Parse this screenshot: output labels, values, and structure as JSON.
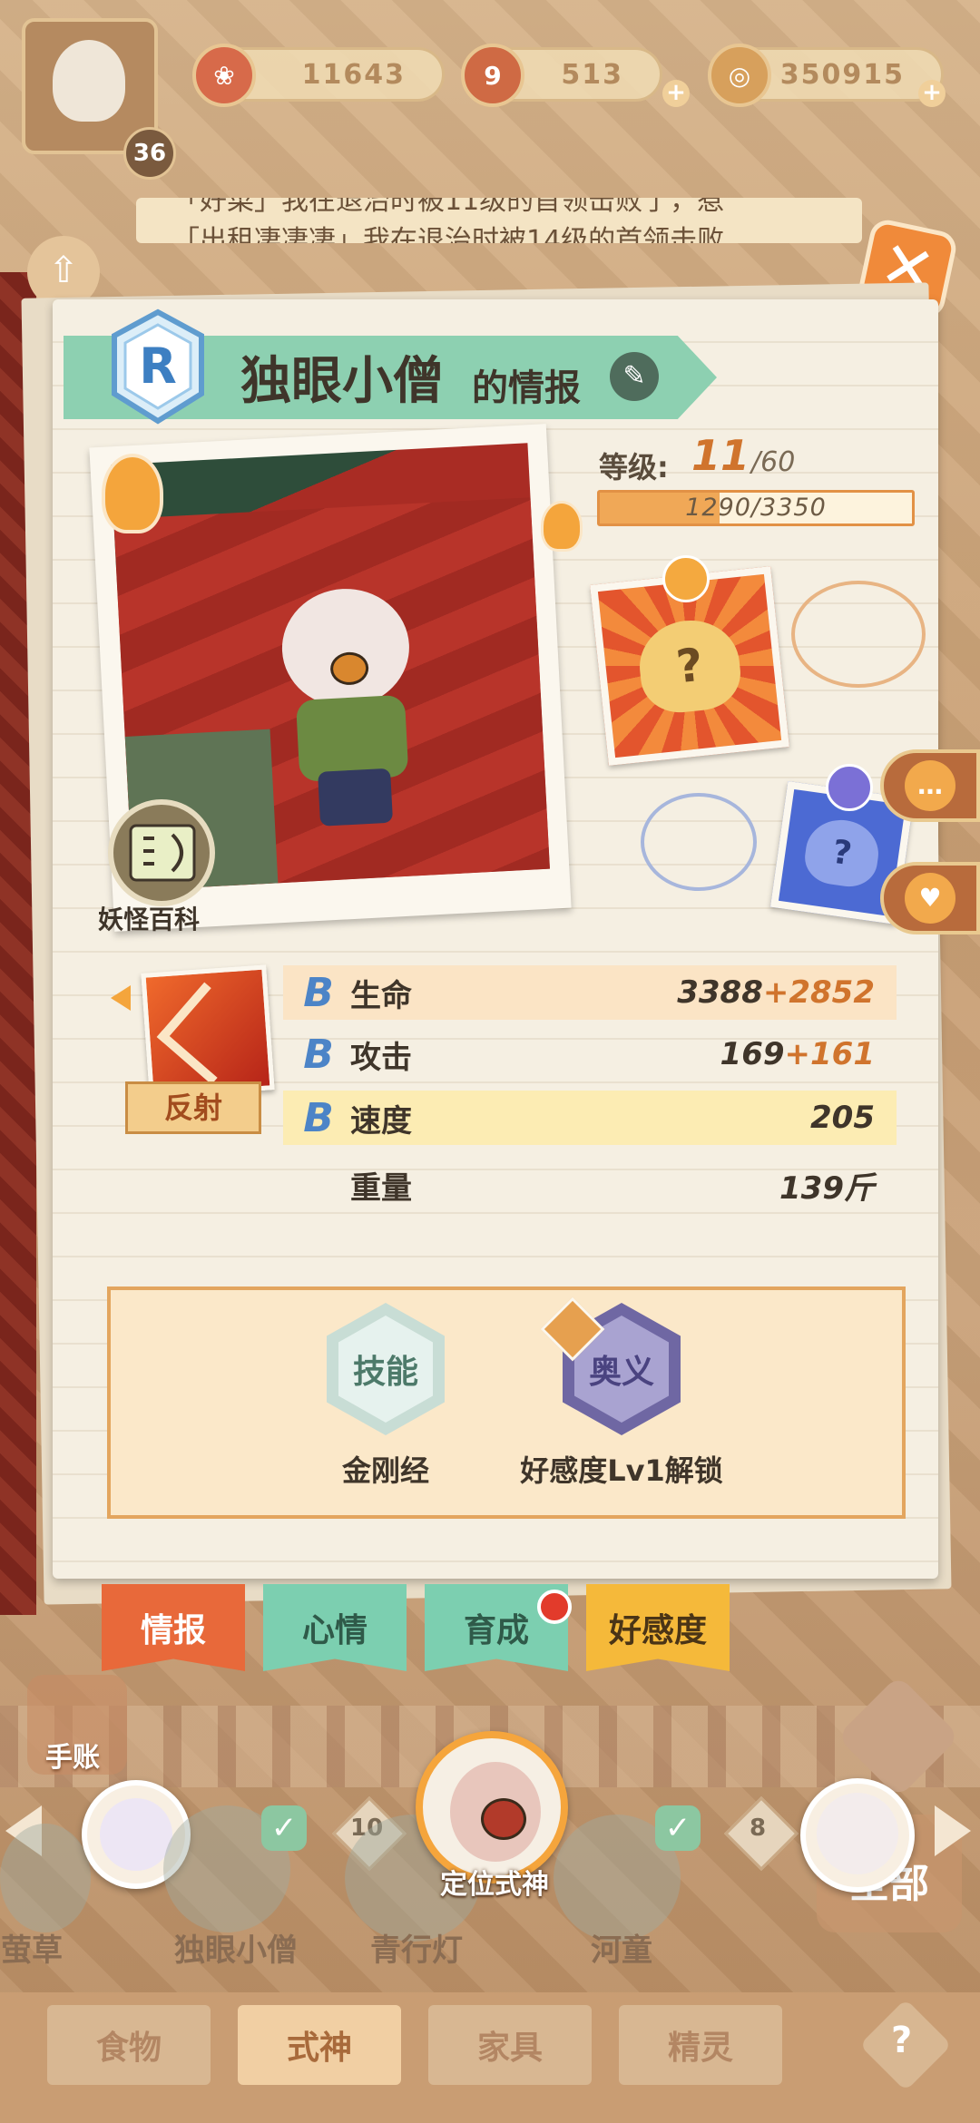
{
  "resources": {
    "player_level": "36",
    "currency_1": "11643",
    "currency_2": "513",
    "currency_3": "350915",
    "plus": "+"
  },
  "ticker": {
    "line1": "「好菜」我在退治时被11级的首领击败了，惹",
    "line2": "「出租凄凄凄」我在退治时被14级的首领击败"
  },
  "header": {
    "rarity": "R",
    "name": "独眼小僧",
    "suffix": "的情报"
  },
  "photo": {
    "wiki_label": "妖怪百科"
  },
  "level": {
    "label": "等级:",
    "current": "11",
    "max": "/60",
    "exp_text": "1290/3350",
    "exp_fraction": 0.385
  },
  "mood": {
    "unknown_mark": "?"
  },
  "skill": {
    "label": "反射"
  },
  "stats": {
    "rows": [
      {
        "grade": "B",
        "name": "生命",
        "base": "3388",
        "bonus": "+2852"
      },
      {
        "grade": "B",
        "name": "攻击",
        "base": "169",
        "bonus": "+161"
      },
      {
        "grade": "B",
        "name": "速度",
        "base": "205",
        "bonus": ""
      },
      {
        "grade": "",
        "name": "重量",
        "base": "139斤",
        "bonus": ""
      }
    ]
  },
  "abilities": {
    "skill_hex": "技能",
    "skill_name": "金刚经",
    "secret_hex": "奥义",
    "secret_unlock": "好感度Lv1解锁"
  },
  "tabs": [
    "情报",
    "心情",
    "育成",
    "好感度"
  ],
  "side": {
    "notebook": "手账",
    "locate": "定位式神",
    "all": "全部"
  },
  "roster": {
    "names": [
      "萤草",
      "独眼小僧",
      "青行灯",
      "河童"
    ],
    "levels": [
      "10",
      "8"
    ]
  },
  "nav": [
    "食物",
    "式神",
    "家具",
    "精灵"
  ],
  "colors": {
    "accent_orange": "#d0742d",
    "header_green": "#8dd0b1",
    "tab_info": "#e8693a",
    "tab_mood": "#7ccfb0",
    "tab_grow": "#7ccfb0",
    "tab_affinity": "#f5b93a"
  }
}
